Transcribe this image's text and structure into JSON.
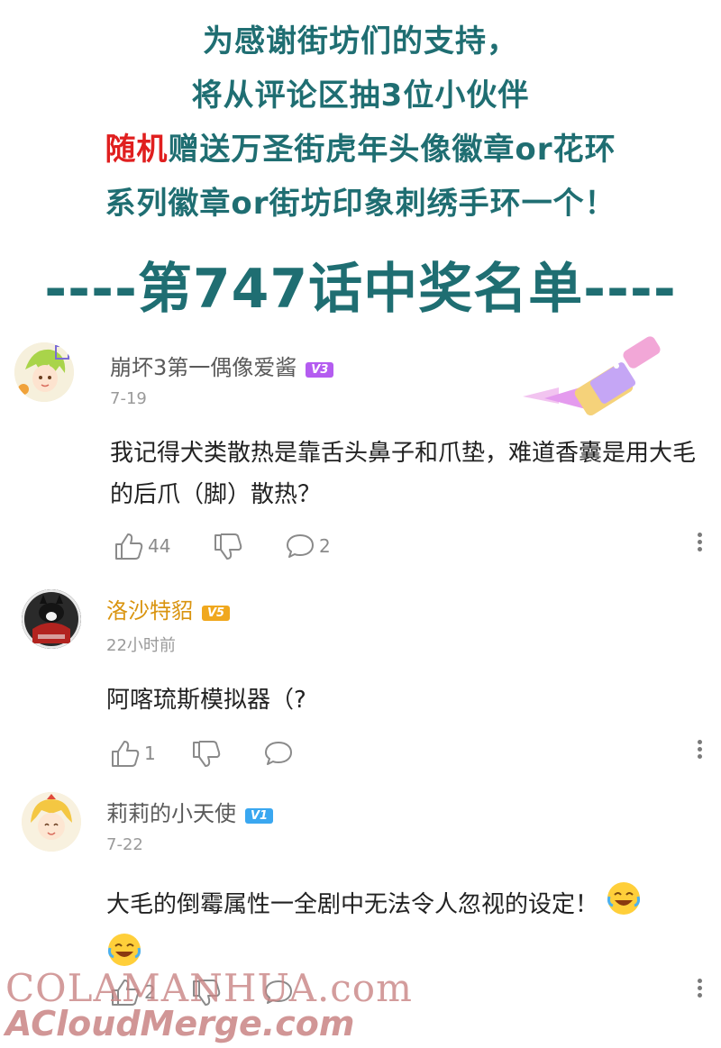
{
  "banner": {
    "line1": "为感谢街坊们的支持，",
    "line2": "将从评论区抽3位小伙伴",
    "line3_red": "随机",
    "line3_rest": "赠送万圣街虎年头像徽章or花环",
    "line4": "系列徽章or街坊印象刺绣手环一个！"
  },
  "title": "----第747话中奖名单----",
  "comments": [
    {
      "username": "崩坏3第一偶像爱酱",
      "level": "V3",
      "level_color": "#b45cf0",
      "date": "7-19",
      "text": "我记得犬类散热是靠舌头鼻子和爪垫，难道香囊是用大毛的后爪（脚）散热？",
      "likes": "44",
      "replies": "2"
    },
    {
      "username": "洛沙特貂",
      "level": "V5",
      "level_color": "#f0a81e",
      "date": "22小时前",
      "text": "阿喀琉斯模拟器（?",
      "likes": "1",
      "replies": ""
    },
    {
      "username": "莉莉的小天使",
      "level": "V1",
      "level_color": "#3aa7f0",
      "date": "7-22",
      "text": "大毛的倒霉属性一全剧中无法令人忽视的设定！",
      "likes": "2",
      "replies": ""
    }
  ],
  "watermark": {
    "line1": "COLAMANHUA.com",
    "line2": "ACloudMerge.com"
  },
  "colors": {
    "accent": "#1f6e72",
    "highlight": "#e01f1f",
    "vip_name": "#d9940f"
  }
}
